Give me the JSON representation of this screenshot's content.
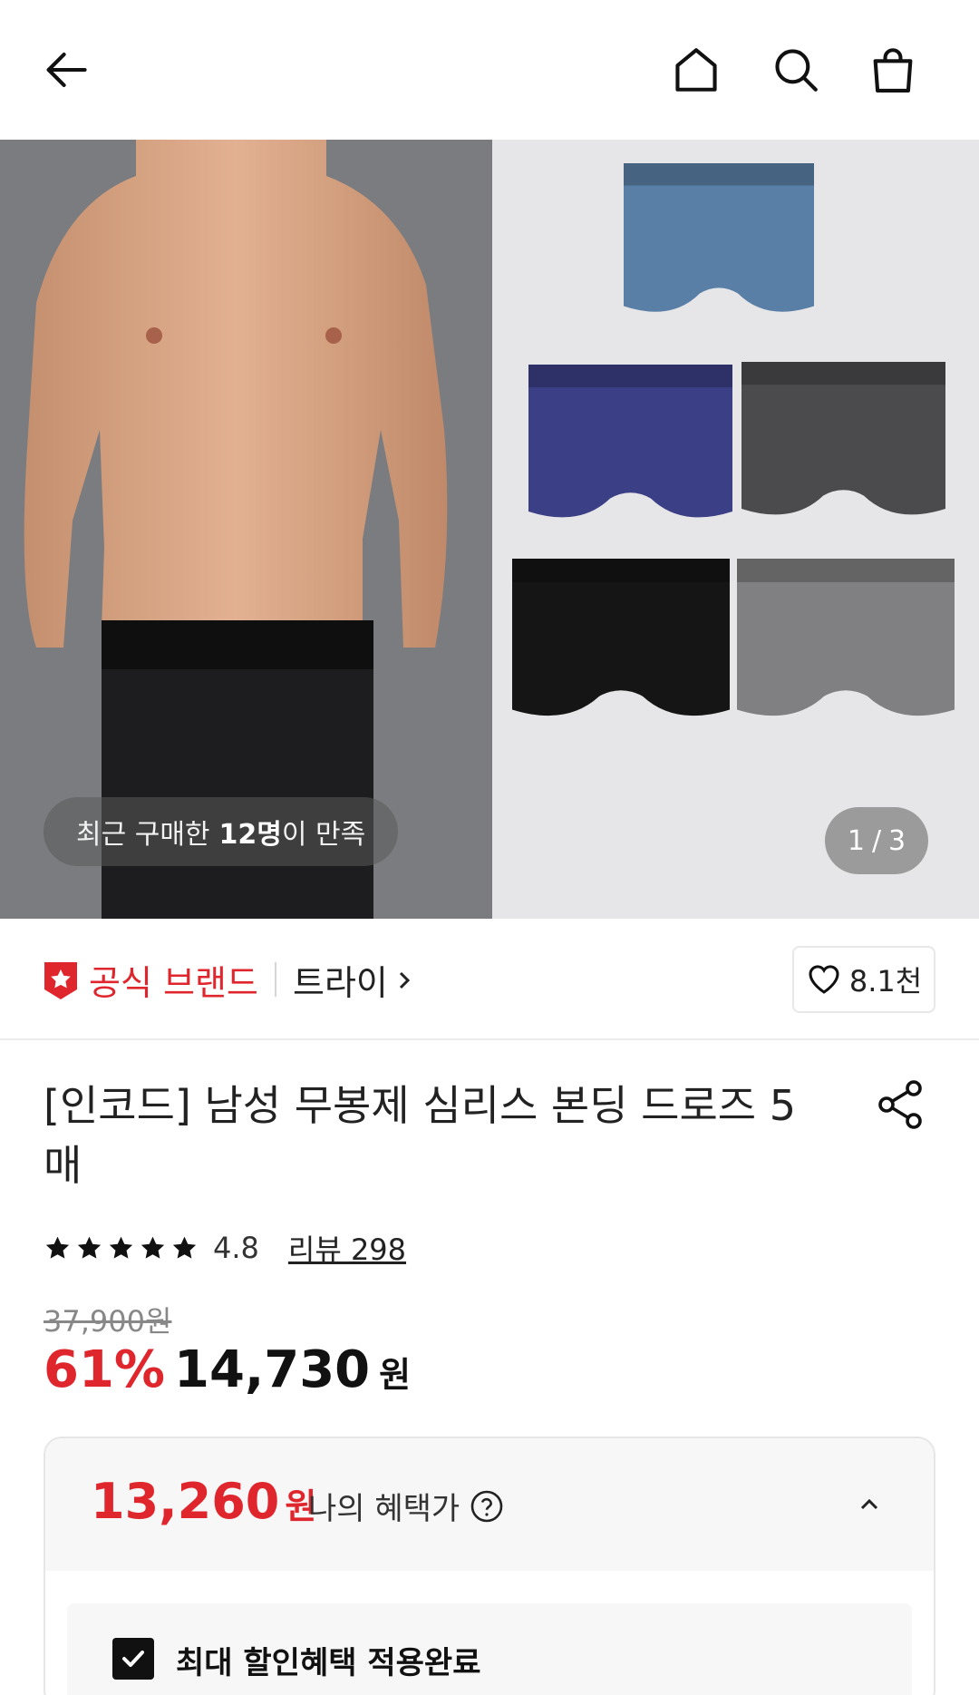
{
  "header": {
    "back_icon": "arrow-left-icon",
    "home_icon": "home-icon",
    "search_icon": "search-icon",
    "cart_icon": "shopping-bag-icon"
  },
  "hero": {
    "satisfaction_prefix": "최근 구매한",
    "satisfaction_count": "12명",
    "satisfaction_suffix": "이 만족",
    "pager_current": "1",
    "pager_sep": "/",
    "pager_total": "3",
    "colors": [
      "#5a7fa6",
      "#3b3f86",
      "#4b4b4d",
      "#151515",
      "#808082"
    ]
  },
  "brand": {
    "official_label": "공식 브랜드",
    "brand_name": "트라이",
    "like_count": "8.1천",
    "accent": "#e0262d"
  },
  "product": {
    "title": "[인코드] 남성 무봉제 심리스 본딩 드로즈 5매",
    "rating": "4.8",
    "stars": 5,
    "review_link": "리뷰 298",
    "original_price": "37,900원",
    "discount": "61%",
    "price": "14,730",
    "price_unit": "원"
  },
  "benefit": {
    "price": "13,260",
    "price_unit": "원",
    "label": "나의 혜택가",
    "applied_label": "최대 할인혜택 적용완료"
  }
}
